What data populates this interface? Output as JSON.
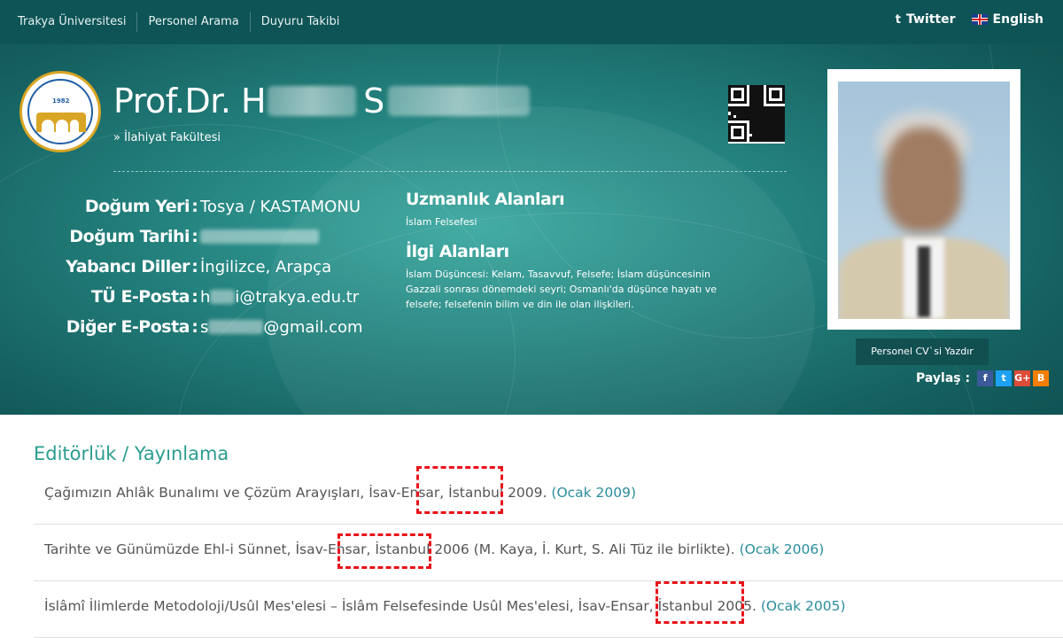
{
  "topnav": [
    "Trakya Üniversitesi",
    "Personel Arama",
    "Duyuru Takibi"
  ],
  "toplinks": {
    "twitter": "Twitter",
    "language": "English",
    "twitter_icon": "twitter-icon",
    "flag_icon": "uk-flag-icon"
  },
  "profile": {
    "name_prefix": "Prof.Dr. H",
    "surname_initial": "S",
    "faculty": "» İlahiyat Fakültesi",
    "logo_year": "1982"
  },
  "info": [
    {
      "label": "Doğum Yeri",
      "value": "Tosya / KASTAMONU"
    },
    {
      "label": "Doğum Tarihi",
      "value": ""
    },
    {
      "label": "Yabancı Diller",
      "value": "İngilizce, Arapça"
    },
    {
      "label": "TÜ E-Posta",
      "value_pre": "h",
      "value_post": "i@trakya.edu.tr"
    },
    {
      "label": "Diğer E-Posta",
      "value_pre": "s",
      "value_post": "@gmail.com"
    }
  ],
  "separator": ":",
  "expertise": {
    "title": "Uzmanlık Alanları",
    "text": "İslam Felsefesi",
    "interest_title": "İlgi Alanları",
    "interest_text": "İslam Düşüncesi: Kelam, Tasavvuf, Felsefe; İslam düşüncesinin Gazzali sonrası dönemdeki seyri; Osmanlı'da düşünce hayatı ve felsefe; felsefenin bilim ve din ile olan ilişkileri."
  },
  "cv_button": "Personel CV`si Yazdır",
  "share": {
    "label": "Paylaş :",
    "icons": [
      "f",
      "t",
      "G+",
      "B"
    ],
    "colors": [
      "#3b5998",
      "#1da1f2",
      "#dd4b39",
      "#f57d00"
    ]
  },
  "section_title": "Editörlük / Yayınlama",
  "publications": [
    {
      "text": "Çağımızın Ahlâk Bunalımı ve Çözüm Arayışları, İsav-Ensar, İstanbul 2009.",
      "date": "(Ocak 2009)"
    },
    {
      "text": "Tarihte ve Günümüzde Ehl-i Sünnet, İsav-Ensar, İstanbul 2006 (M. Kaya, İ. Kurt, S. Ali Tüz ile birlikte).",
      "date": "(Ocak 2006)"
    },
    {
      "text": "İslâmî İlimlerde Metodoloji/Usûl Mes'elesi – İslâm Felsefesinde Usûl Mes'elesi, İsav-Ensar, İstanbul 2005.",
      "date": "(Ocak 2005)"
    }
  ],
  "colors": {
    "teal": "#23807c",
    "title_teal": "#2a9d8f",
    "highlight_red": "#e8121a"
  }
}
